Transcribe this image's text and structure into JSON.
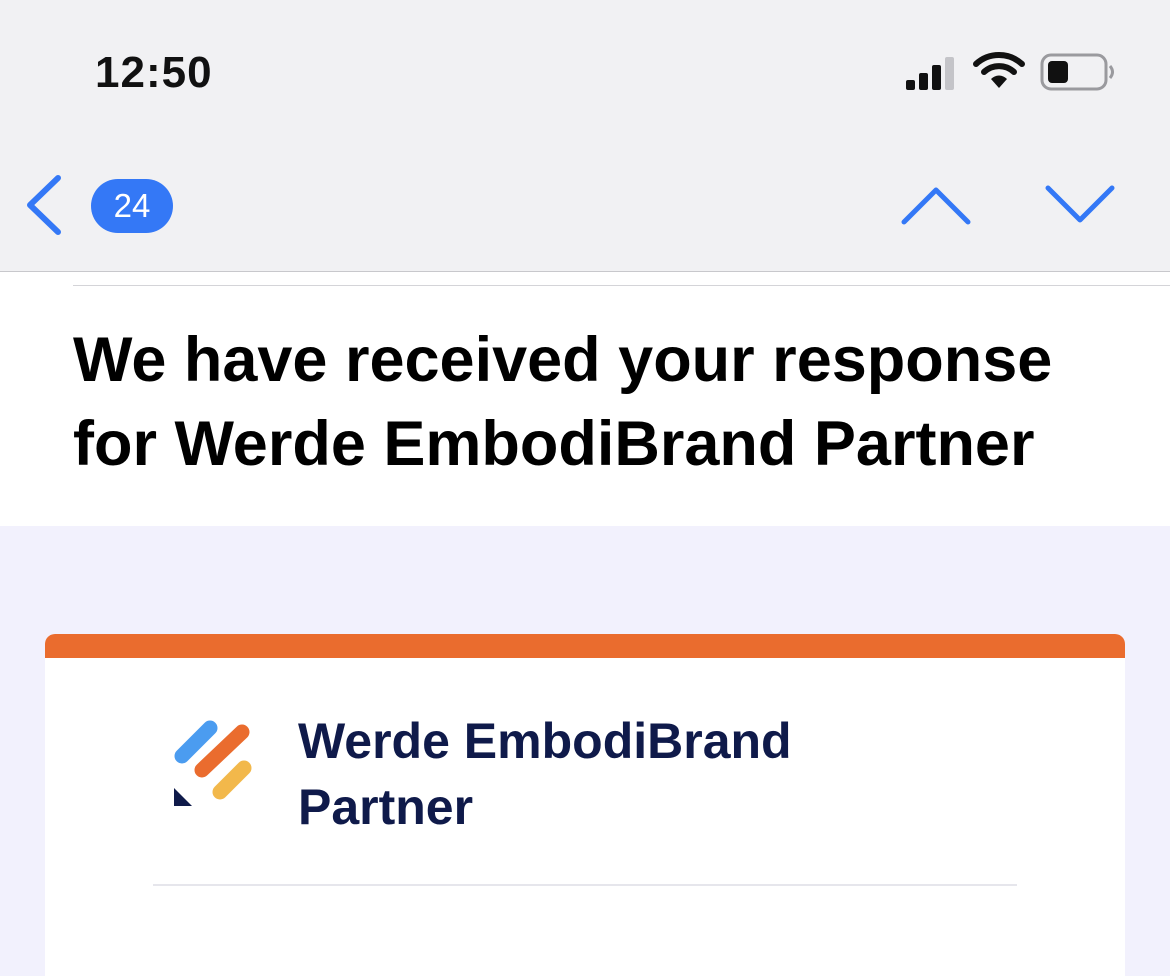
{
  "status_bar": {
    "time": "12:50"
  },
  "nav_bar": {
    "unread_count": "24"
  },
  "mail": {
    "subject": "We have received your response for Werde EmbodiBrand Partner"
  },
  "card": {
    "form_title": "Werde EmbodiBrand Partner"
  },
  "colors": {
    "accent_blue": "#3478f6",
    "card_accent_orange": "#ea6c2e",
    "title_navy": "#0f1a4a",
    "body_background": "#f2f1fd",
    "logo_blue": "#4b9cf0",
    "logo_orange": "#ea6c2e",
    "logo_yellow": "#f2b84b",
    "logo_navy": "#0f1a4a"
  },
  "icons": {
    "back": "chevron-left-icon",
    "previous": "chevron-up-icon",
    "next": "chevron-down-icon",
    "signal": "cellular-signal-icon",
    "wifi": "wifi-icon",
    "battery": "battery-icon",
    "logo": "jotform-logo-icon"
  }
}
